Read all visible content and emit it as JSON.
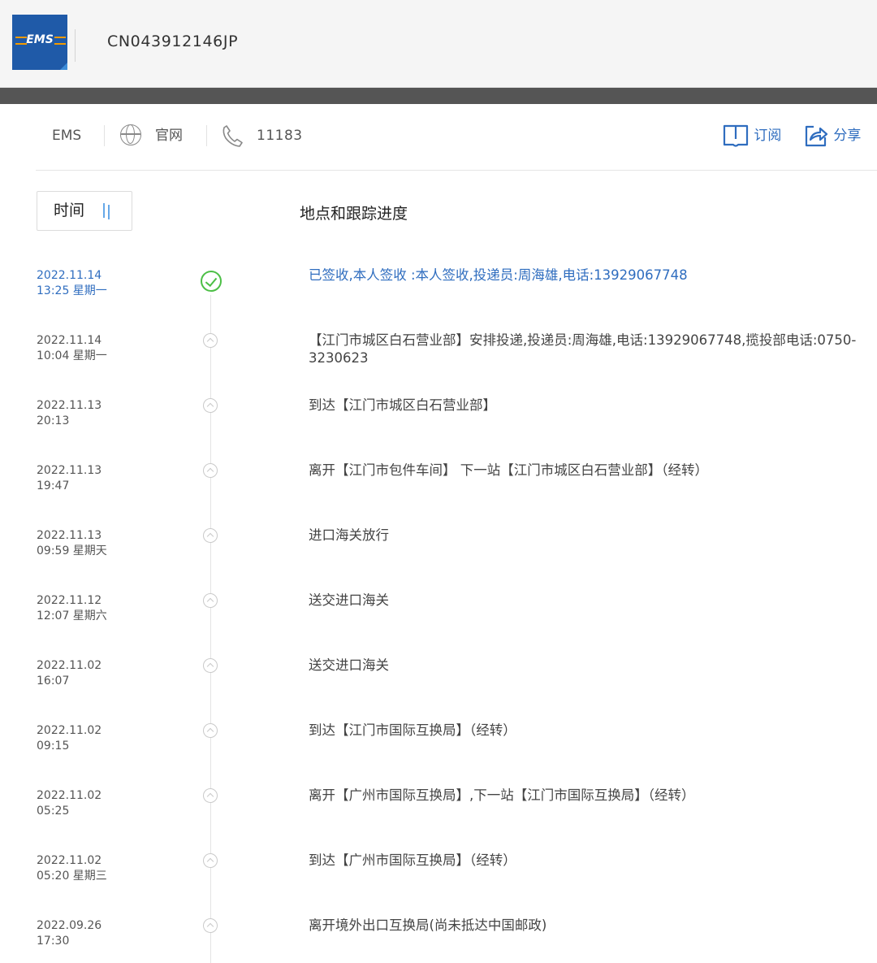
{
  "header": {
    "logo_text": "EMS",
    "tracking_number": "CN043912146JP"
  },
  "toolbar": {
    "carrier": "EMS",
    "website_label": "官网",
    "phone": "11183",
    "subscribe_label": "订阅",
    "share_label": "分享"
  },
  "list_header": {
    "time_label": "时间",
    "progress_label": "地点和跟踪进度"
  },
  "colors": {
    "accent": "#2f6dbf",
    "done": "#4cbf46"
  },
  "events": [
    {
      "date": "2022.11.14",
      "time": "13:25 星期一",
      "text": "已签收,本人签收 :本人签收,投递员:周海雄,电话:13929067748"
    },
    {
      "date": "2022.11.14",
      "time": "10:04 星期一",
      "text": "【江门市城区白石营业部】安排投递,投递员:周海雄,电话:13929067748,揽投部电话:0750-3230623"
    },
    {
      "date": "2022.11.13",
      "time": "20:13",
      "text": "到达【江门市城区白石营业部】"
    },
    {
      "date": "2022.11.13",
      "time": "19:47",
      "text": "离开【江门市包件车间】 下一站【江门市城区白石营业部】（经转）"
    },
    {
      "date": "2022.11.13",
      "time": "09:59 星期天",
      "text": "进口海关放行"
    },
    {
      "date": "2022.11.12",
      "time": "12:07 星期六",
      "text": "送交进口海关"
    },
    {
      "date": "2022.11.02",
      "time": "16:07",
      "text": "送交进口海关"
    },
    {
      "date": "2022.11.02",
      "time": "09:15",
      "text": "到达【江门市国际互换局】（经转）"
    },
    {
      "date": "2022.11.02",
      "time": "05:25",
      "text": "离开【广州市国际互换局】,下一站【江门市国际互换局】（经转）"
    },
    {
      "date": "2022.11.02",
      "time": "05:20 星期三",
      "text": "到达【广州市国际互换局】（经转）"
    },
    {
      "date": "2022.09.26",
      "time": "17:30",
      "text": "离开境外出口互换局(尚未抵达中国邮政)"
    }
  ]
}
